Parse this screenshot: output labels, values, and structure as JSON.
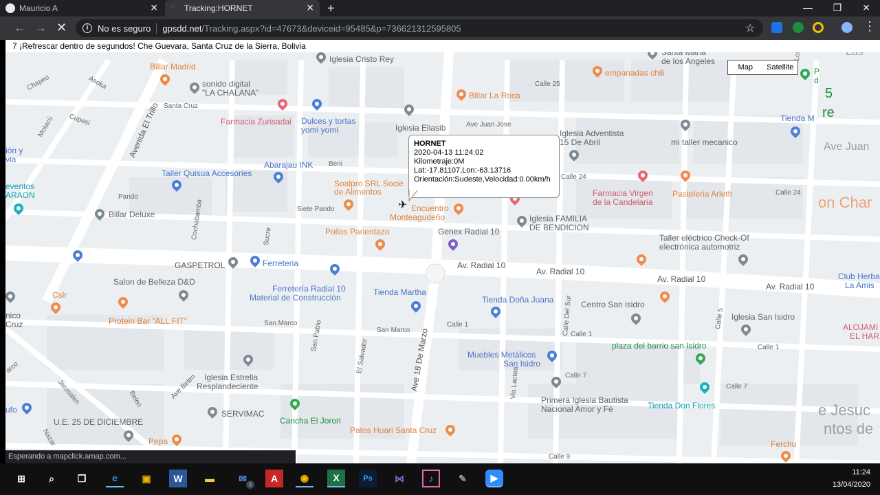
{
  "browser": {
    "tabs": [
      {
        "title": "Mauricio A",
        "active": false
      },
      {
        "title": "Tracking:HORNET",
        "active": true
      }
    ],
    "new_tab": "+",
    "window_controls": [
      "—",
      "❐",
      "✕"
    ],
    "security_label": "No es seguro",
    "url_host": "gpsdd.net",
    "url_path": "/Tracking.aspx?id=47673&deviceid=95485&p=736621312595805",
    "status_text": "Esperando a mapclick.amap.com..."
  },
  "page": {
    "refresh_line": "7 ¡Refrescar dentro de segundos!  Che Guevara, Santa Cruz de la Sierra, Bolivia",
    "map_type": {
      "map": "Map",
      "satellite": "Satellite"
    }
  },
  "infowindow": {
    "title": "HORNET",
    "datetime": "2020-04-13 11:24:02",
    "km": "Kilometraje:0M",
    "latlon": "Lat:-17.81107,Lon:-63.13716",
    "orient": "Orientación:Sudeste,Velocidad:0.00km/h"
  },
  "map_labels": {
    "billar_madrid": "Billar Madrid",
    "sonido": "sonido digital",
    "la_chalana": "\"LA CHALANA\"",
    "iglesia_cristo": "Iglesia Cristo Rey",
    "santa_maria": "Santa Maria",
    "de_los_angeles": "de los Angeles",
    "empanadas": "empanadas chili",
    "billar_la_roca": "Billar La Roca",
    "farmacia_zurisadai": "Farmacia Zurisadai",
    "dulces": "Dulces y tortas",
    "yomi": "yomi yomi",
    "iglesia_eliasib": "Iglesia Eliasib",
    "iglesia_adventista": "Iglesia Adventista",
    "quince_abril": "15 De Abril",
    "mi_taller": "mi taller mecanico",
    "tienda_m": "Tienda M",
    "abarajau": "Abarajau INK",
    "taller_quisua": "Taller Quisua Accesories",
    "soalpro": "Soalpro SRL Socie",
    "alimentos": "de Alimentos",
    "farmacia_virgen": "Farmacia Virgen",
    "candelaria": "de la Candelaria",
    "pasteleria": "Pasteleria Arleth",
    "billar_deluxe": "Billar Deluxe",
    "encuentro": "Encuentro",
    "monteagudeno": "Monteagudeño",
    "iglesia_familia": "Iglesia FAMILIA",
    "de_bendicion": "DE BENDICION",
    "genex": "Genex Radial 10",
    "pollos": "Pollos Parientazo",
    "taller_check": "Taller eléctrico Check-Of",
    "electronica": "electrónica automotriz",
    "gaspetrol": "GASPETROL",
    "ferreteria": "Ferreteria",
    "av_radial_1": "Av. Radial 10",
    "av_radial_2": "Av. Radial 10",
    "av_radial_3": "Av. Radial 10",
    "av_radial_4": "Av. Radial 10",
    "salon": "Salon de Belleza D&D",
    "ferreteria_radial": "Ferretería Radial 10",
    "material": "Material de Construcción",
    "tienda_martha": "Tienda Martha",
    "tienda_dona": "Tienda Doña Juana",
    "centro_san": "Centro San isidro",
    "club_herba": "Club Herba",
    "la_amis": "La Amis",
    "cslr": "Cslr",
    "protein": "Protein Bar \"ALL FIT\"",
    "iglesia_san_isidro": "Iglesia San Isidro",
    "alojam": "ALOJAMI",
    "el_har": "EL HAR",
    "plaza": "plaza del barrio san Isidro",
    "muebles": "Muebles Metálicos",
    "san_isidro": "San Isidro",
    "iglesia_estrella": "Iglesia Estrella",
    "resplandeciente": "Resplandeciente",
    "primera_iglesia": "Primera Iglesia Bautista",
    "nacional": "Nacional Amor y Fé",
    "tienda_don": "Tienda Don Flores",
    "ue25": "U.E. 25 DE DICIEMBRE",
    "servimac": "SERVIMAC",
    "cancha": "Cancha El Jorori",
    "patos": "Patos Huari Santa Cruz",
    "pepa": "Pepa",
    "ferchu": "Ferchu",
    "eventos": "eventos",
    "araon": "ARAON",
    "ion_y": "ión y",
    "via": "via",
    "nico": "nico",
    "cruz": "Cruz",
    "ufo": "ufo",
    "arco": "arco",
    "las": "Las",
    "ave_juan": "Ave Juan",
    "on_char": "on Char",
    "e_jesuc": "e Jesuc",
    "ntos_de": "ntos de",
    "five": "5",
    "re": "re",
    "calle25": "Calle 25",
    "ave_juan_jose": "Ave Juan Jose",
    "calle24a": "Calle 24",
    "calle24b": "Calle 24",
    "santa_cruz": "Santa Cruz",
    "beni": "Beni",
    "pando": "Pando",
    "siete_pando": "Siete Pando",
    "cochabamba": "Cochabamba",
    "sucre": "Sucre",
    "avenida_trillo": "Avenida El Trillo",
    "chapeo": "Chapeo",
    "asoka": "Asoka",
    "cupesi": "Cupesi",
    "motacu": "Motacú",
    "san_marco1": "San Marco",
    "san_marco2": "San Marco",
    "calle1a": "Calle 1",
    "calle1b": "Calle 1",
    "calle1c": "Calle 1",
    "calle7a": "Calle 7",
    "calle7b": "Calle 7",
    "calle9": "Calle 9",
    "calle5": "Calle 5",
    "ave18": "Ave 18 De Marzo",
    "calle_del_sur": "Calle Del Sur",
    "via_lactea": "Via Lactea",
    "san_pablo": "San Pablo",
    "el_salvador": "El Salvador",
    "ave_belen": "Ave Belen",
    "jerusalen": "Jerusalen",
    "belen": "Belen",
    "nazar": "Nazar",
    "los": "Los",
    "th": "th",
    "p_label": "P",
    "d_label": "d"
  },
  "taskbar": {
    "time": "11:24",
    "date": "13/04/2020",
    "mail_badge": "8"
  }
}
